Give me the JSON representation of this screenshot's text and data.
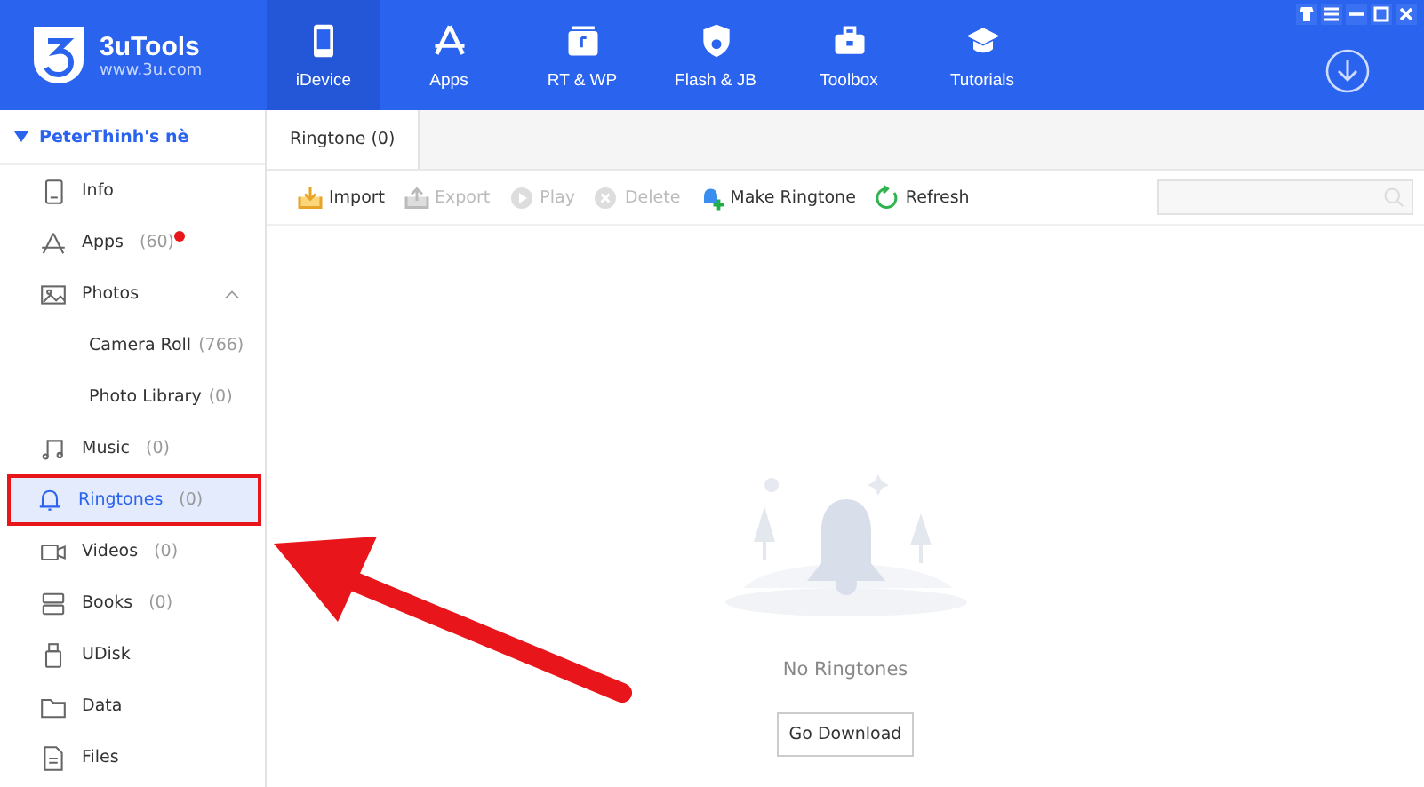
{
  "app": {
    "name": "3uTools",
    "site": "www.3u.com"
  },
  "nav": [
    {
      "label": "iDevice",
      "selected": true
    },
    {
      "label": "Apps",
      "selected": false
    },
    {
      "label": "RT & WP",
      "selected": false
    },
    {
      "label": "Flash & JB",
      "selected": false
    },
    {
      "label": "Toolbox",
      "selected": false
    },
    {
      "label": "Tutorials",
      "selected": false
    }
  ],
  "device": {
    "name": "PeterThinh's nè",
    "expanded": true
  },
  "sidebar": [
    {
      "label": "Info",
      "selected": false,
      "highlighted": false
    },
    {
      "label": "Apps",
      "count": "(60)",
      "badge": true,
      "selected": false,
      "highlighted": false
    },
    {
      "label": "Photos",
      "expanded": true,
      "selected": false,
      "highlighted": false,
      "children": [
        {
          "label": "Camera Roll",
          "count": "(766)"
        },
        {
          "label": "Photo Library",
          "count": "(0)"
        }
      ]
    },
    {
      "label": "Music",
      "count": "(0)",
      "selected": false,
      "highlighted": false
    },
    {
      "label": "Ringtones",
      "count": "(0)",
      "selected": true,
      "highlighted": true
    },
    {
      "label": "Videos",
      "count": "(0)",
      "selected": false,
      "highlighted": false
    },
    {
      "label": "Books",
      "count": "(0)",
      "selected": false,
      "highlighted": false
    },
    {
      "label": "UDisk",
      "selected": false,
      "highlighted": false
    },
    {
      "label": "Data",
      "selected": false,
      "highlighted": false
    },
    {
      "label": "Files",
      "selected": false,
      "highlighted": false
    }
  ],
  "tabs": [
    {
      "label": "Ringtone (0)",
      "selected": true
    }
  ],
  "toolbar": [
    {
      "label": "Import",
      "disabled": false
    },
    {
      "label": "Export",
      "disabled": true
    },
    {
      "label": "Play",
      "disabled": true
    },
    {
      "label": "Delete",
      "disabled": true
    },
    {
      "label": "Make Ringtone",
      "disabled": false
    },
    {
      "label": "Refresh",
      "disabled": false
    }
  ],
  "empty_state": {
    "message": "No Ringtones",
    "button": "Go Download"
  },
  "annotation_arrow": true
}
